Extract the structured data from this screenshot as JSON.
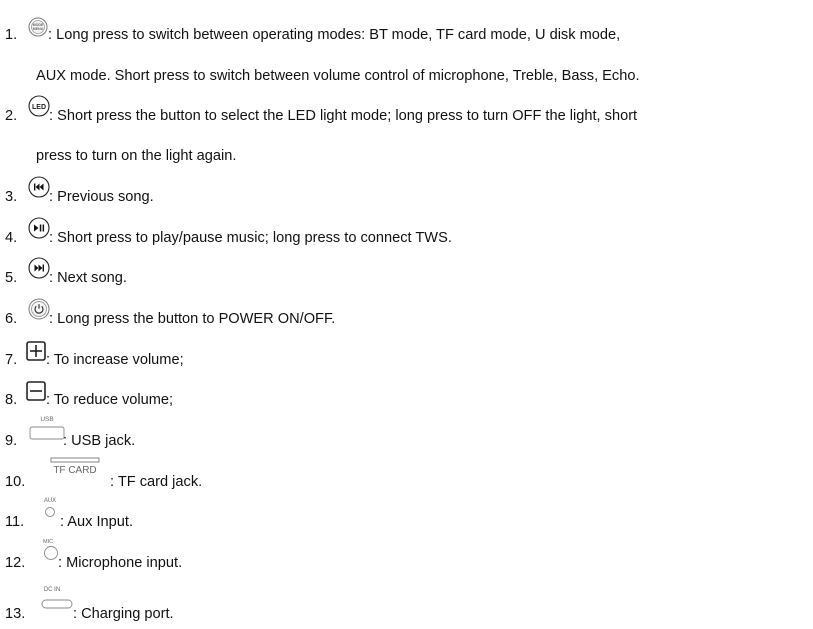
{
  "items": [
    {
      "num": "1.",
      "icon": "mode-menu-button-icon",
      "text": ": Long press to switch between operating modes: BT mode, TF card mode, U disk mode,",
      "cont": "AUX mode. Short press to switch between volume control of microphone, Treble, Bass, Echo."
    },
    {
      "num": "2.",
      "icon": "led-button-icon",
      "text": ": Short press the button to select the LED light mode; long press to turn OFF the light, short",
      "cont": "press to turn on the light again."
    },
    {
      "num": "3.",
      "icon": "previous-button-icon",
      "text": ": Previous song."
    },
    {
      "num": "4.",
      "icon": "play-pause-button-icon",
      "text": ": Short press to play/pause music; long press to connect TWS."
    },
    {
      "num": "5.",
      "icon": "next-button-icon",
      "text": ": Next song."
    },
    {
      "num": "6.",
      "icon": "power-button-icon",
      "text": ": Long press the button to POWER ON/OFF."
    },
    {
      "num": "7.",
      "icon": "plus-button-icon",
      "text": ": To increase volume;"
    },
    {
      "num": "8.",
      "icon": "minus-button-icon",
      "text": ": To reduce volume;"
    },
    {
      "num": "9.",
      "icon": "usb-port-icon",
      "text": ": USB jack."
    },
    {
      "num": "10.",
      "icon": "tf-card-slot-icon",
      "text": ": TF card jack."
    },
    {
      "num": "11.",
      "icon": "aux-port-icon",
      "text": ": Aux Input."
    },
    {
      "num": "12.",
      "icon": "mic-port-icon",
      "text": ": Microphone input."
    },
    {
      "num": "13.",
      "icon": "dc-in-port-icon",
      "text": ": Charging port."
    }
  ],
  "icon_labels": {
    "mode_line1": "MODE",
    "mode_line2": "MENU",
    "led": "LED",
    "usb": "USB",
    "tf_card": "TF CARD",
    "aux": "AUX",
    "mic": "MIC",
    "dc_in": "DC IN"
  }
}
